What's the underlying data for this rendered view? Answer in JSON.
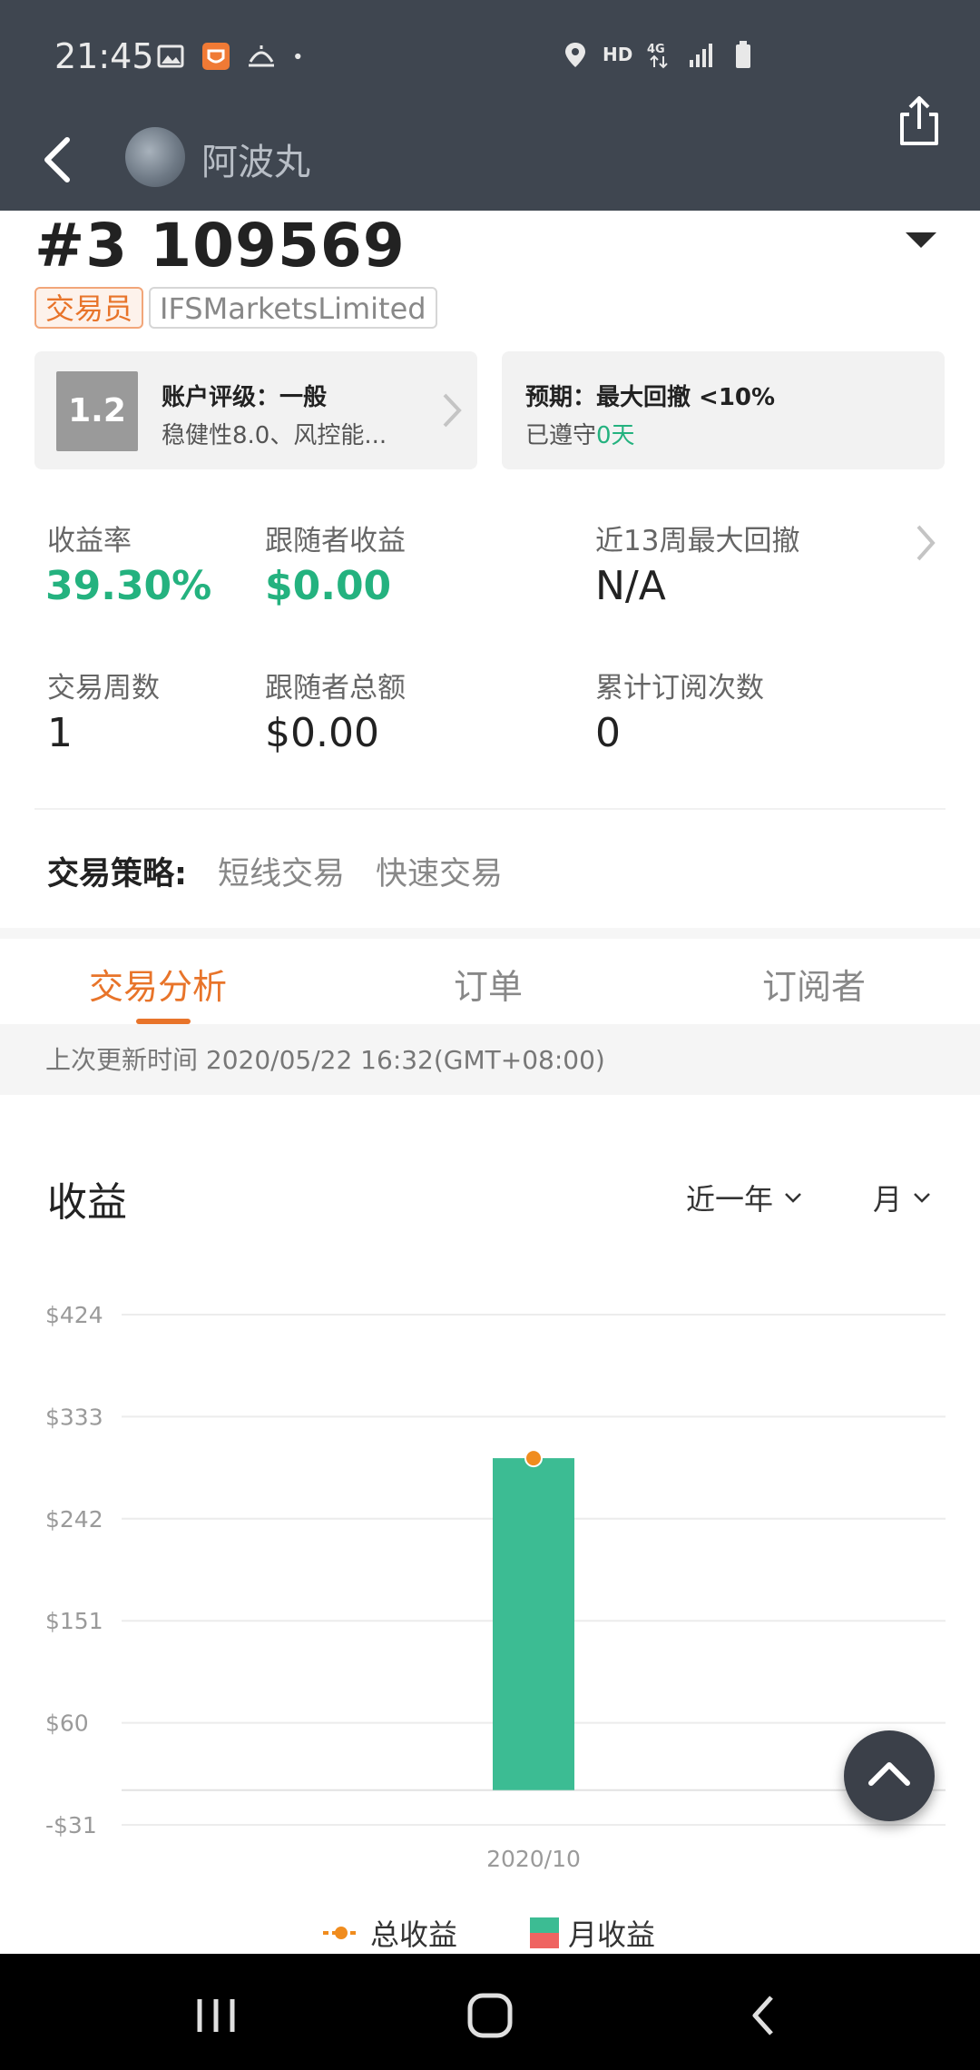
{
  "status_bar": {
    "time": "21:45",
    "network_label": "HD",
    "icons": [
      "gallery-icon",
      "app-notification-icon",
      "weather-icon",
      "dot-icon",
      "location-icon",
      "hd-icon",
      "4g-icon",
      "signal-icon",
      "battery-icon"
    ]
  },
  "header": {
    "username": "阿波丸"
  },
  "trader": {
    "id": "#3 109569",
    "role_tag": "交易员",
    "broker_tag": "IFSMarketsLimited"
  },
  "rating_card": {
    "score": "1.2",
    "title": "账户评级：一般",
    "subtitle": "稳健性8.0、风控能..."
  },
  "expectation_card": {
    "title": "预期：最大回撤 <10%",
    "subtitle_prefix": "已遵守",
    "subtitle_value": "0天"
  },
  "stats": {
    "return_rate_label": "收益率",
    "return_rate_value": "39.30%",
    "follower_profit_label": "跟随者收益",
    "follower_profit_value": "$0.00",
    "max_drawdown_label": "近13周最大回撤",
    "max_drawdown_value": "N/A",
    "weeks_label": "交易周数",
    "weeks_value": "1",
    "follower_total_label": "跟随者总额",
    "follower_total_value": "$0.00",
    "subscriptions_label": "累计订阅次数",
    "subscriptions_value": "0"
  },
  "strategy": {
    "label": "交易策略:",
    "items": [
      "短线交易",
      "快速交易"
    ]
  },
  "tabs": [
    {
      "label": "交易分析",
      "active": true
    },
    {
      "label": "订单",
      "active": false
    },
    {
      "label": "订阅者",
      "active": false
    }
  ],
  "update_text": "上次更新时间 2020/05/22 16:32(GMT+08:00)",
  "chart_section": {
    "title": "收益",
    "period_dropdown": "近一年",
    "granularity_dropdown": "月"
  },
  "chart_data": {
    "type": "bar",
    "categories": [
      "2020/10"
    ],
    "series": [
      {
        "name": "月收益",
        "type": "bar",
        "values": [
          296
        ],
        "color": "#3cbc93"
      },
      {
        "name": "总收益",
        "type": "line",
        "values": [
          296
        ],
        "color": "#f08c1e"
      }
    ],
    "y_ticks": [
      "$424",
      "$333",
      "$242",
      "$151",
      "$60",
      "-$31"
    ],
    "ylim": [
      -31,
      424
    ],
    "xlabel": "",
    "ylabel": "",
    "grid": true,
    "legend_position": "bottom-center"
  },
  "legend": {
    "total_label": "总收益",
    "monthly_label": "月收益"
  },
  "colors": {
    "header_bg": "#3f4650",
    "accent_orange": "#e8742a",
    "accent_green": "#24b27f",
    "bar_green": "#3cbc93",
    "line_orange": "#f08c1e"
  }
}
